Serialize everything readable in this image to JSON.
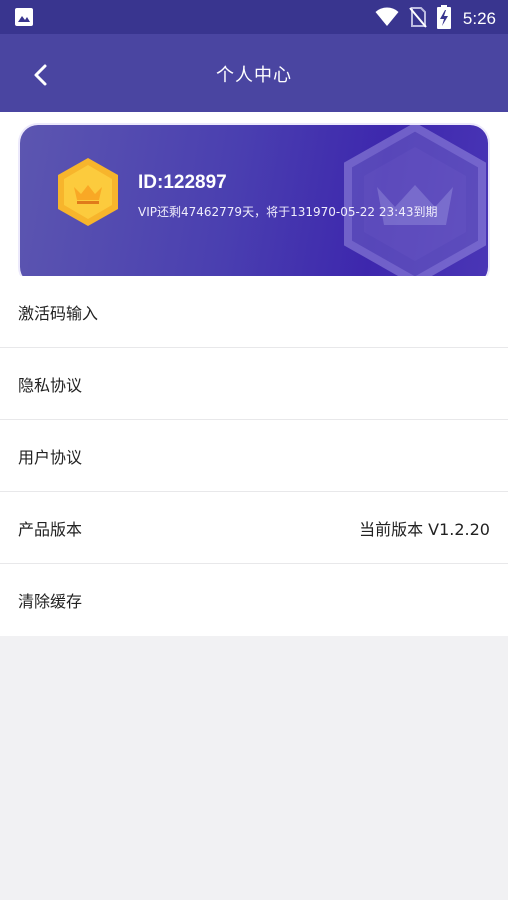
{
  "status_bar": {
    "time": "5:26",
    "icons": [
      "image-icon",
      "wifi-icon",
      "no-sim-icon",
      "battery-charging-icon"
    ]
  },
  "app_bar": {
    "title": "个人中心",
    "back_icon": "chevron-left-icon"
  },
  "vip_card": {
    "id_text": "ID:122897",
    "expire_text": "VIP还剩47462779天，将于131970-05-22 23:43到期",
    "badge_icon": "crown-icon"
  },
  "menu": {
    "items": [
      {
        "label": "激活码输入",
        "value": ""
      },
      {
        "label": "隐私协议",
        "value": ""
      },
      {
        "label": "用户协议",
        "value": ""
      },
      {
        "label": "产品版本",
        "value": "当前版本 V1.2.20"
      },
      {
        "label": "清除缓存",
        "value": ""
      }
    ]
  },
  "colors": {
    "app_bar": "#4a45a1",
    "status_bar": "#39358f",
    "card_gradient_start": "#5c56b0",
    "card_gradient_end": "#3d27ad",
    "badge_gold": "#f7b52c",
    "background": "#f1f1f3"
  }
}
